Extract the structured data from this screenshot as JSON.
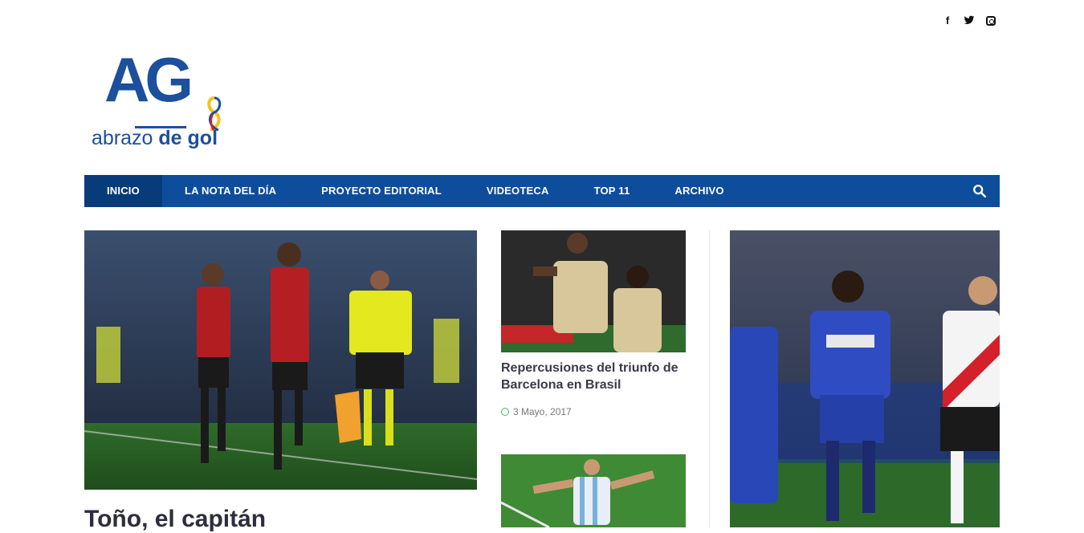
{
  "social": {
    "icons": [
      "facebook-icon",
      "twitter-icon",
      "instagram-icon"
    ],
    "facebook_glyph": "f",
    "twitter_glyph": "t"
  },
  "logo": {
    "mark": "AG",
    "word_light": "abrazo",
    "word_bold": "de gol"
  },
  "nav": {
    "items": [
      {
        "label": "INICIO",
        "active": true
      },
      {
        "label": "LA NOTA DEL DÍA",
        "active": false
      },
      {
        "label": "PROYECTO EDITORIAL",
        "active": false
      },
      {
        "label": "VIDEOTECA",
        "active": false
      },
      {
        "label": "TOP 11",
        "active": false
      },
      {
        "label": "ARCHIVO",
        "active": false
      }
    ],
    "search_icon": "search-icon"
  },
  "colors": {
    "brand": "#0d4d9c",
    "brand_dark": "#083b7a",
    "date_icon": "#3fbf6a"
  },
  "hero": {
    "title": "Toño, el capitán"
  },
  "cards": [
    {
      "title": "Repercusiones del triunfo de Barcelona en Brasil",
      "date": "3 Mayo, 2017"
    }
  ]
}
